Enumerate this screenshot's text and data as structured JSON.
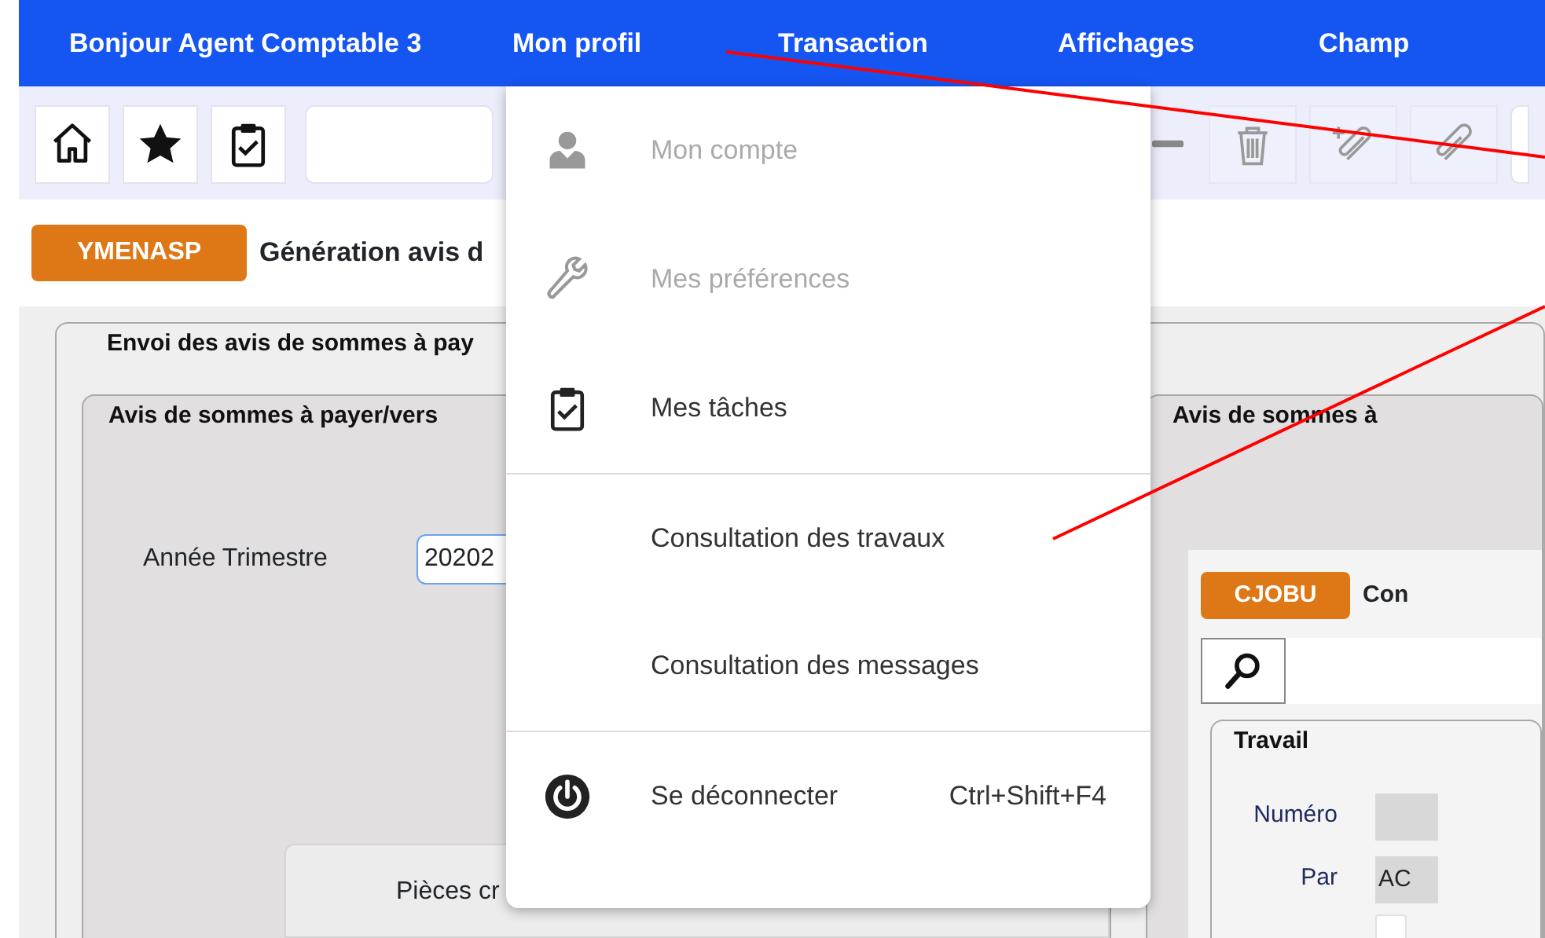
{
  "header": {
    "greeting": "Bonjour Agent Comptable 3",
    "menus": [
      "Mon profil",
      "Transaction",
      "Affichages",
      "Champ"
    ]
  },
  "toolbar": {
    "left": [
      {
        "kind": "home",
        "disabled": false
      },
      {
        "kind": "star",
        "disabled": false
      },
      {
        "kind": "tasks",
        "disabled": false
      }
    ],
    "right": [
      {
        "kind": "trash",
        "disabled": true
      },
      {
        "kind": "clip-plus",
        "disabled": true
      },
      {
        "kind": "clip",
        "disabled": true
      }
    ]
  },
  "screen": {
    "code": "YMENASP",
    "title": "Génération avis d"
  },
  "form": {
    "legend": "Envoi des avis de sommes à pay",
    "left": {
      "legend": "Avis de sommes à payer/vers",
      "field_label": "Année Trimestre",
      "field_value": "20202",
      "box_text": "Pièces cr"
    },
    "right": {
      "legend": "Avis de sommes à",
      "code": "CJOBU",
      "title": "Con",
      "group": "Travail",
      "rows": [
        {
          "label": "Numéro",
          "value": ""
        },
        {
          "label": "Par",
          "value": "AC"
        }
      ],
      "checkbox": {
        "checked": false
      }
    }
  },
  "dropdown": {
    "groups": [
      [
        {
          "kind": "person",
          "label": "Mon compte",
          "disabled": true
        },
        {
          "kind": "wrench",
          "label": "Mes préférences",
          "disabled": true
        },
        {
          "kind": "tasks",
          "label": "Mes tâches",
          "disabled": false
        }
      ],
      [
        {
          "label": "Consultation des travaux",
          "disabled": false
        },
        {
          "label": "Consultation des messages",
          "disabled": false
        }
      ],
      [
        {
          "kind": "power",
          "label": "Se déconnecter",
          "shortcut": "Ctrl+Shift+F4",
          "disabled": false
        }
      ]
    ]
  }
}
